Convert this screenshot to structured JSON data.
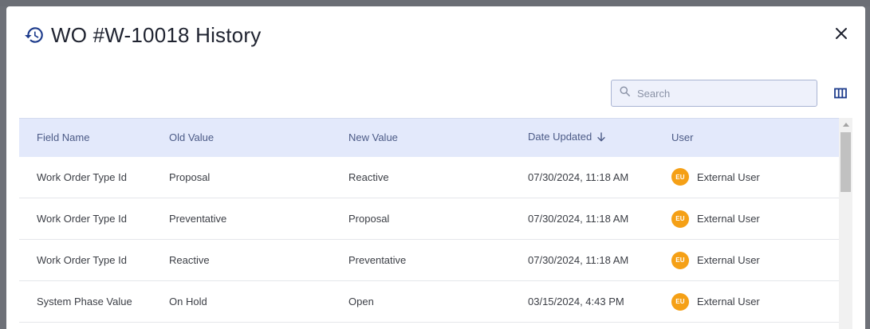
{
  "modal": {
    "title": "WO #W-10018 History",
    "icons": {
      "title": "history-icon",
      "close": "close-icon",
      "search": "search-icon",
      "columns": "columns-icon",
      "sort": "arrow-down-icon"
    }
  },
  "search": {
    "placeholder": "Search",
    "value": ""
  },
  "table": {
    "columns": [
      "Field Name",
      "Old Value",
      "New Value",
      "Date Updated",
      "User"
    ],
    "sorted_column": "Date Updated",
    "sort_direction": "descending",
    "rows": [
      {
        "field_name": "Work Order Type Id",
        "old_value": "Proposal",
        "new_value": "Reactive",
        "date_updated": "07/30/2024, 11:18 AM",
        "user_initials": "EU",
        "user_name": "External User"
      },
      {
        "field_name": "Work Order Type Id",
        "old_value": "Preventative",
        "new_value": "Proposal",
        "date_updated": "07/30/2024, 11:18 AM",
        "user_initials": "EU",
        "user_name": "External User"
      },
      {
        "field_name": "Work Order Type Id",
        "old_value": "Reactive",
        "new_value": "Preventative",
        "date_updated": "07/30/2024, 11:18 AM",
        "user_initials": "EU",
        "user_name": "External User"
      },
      {
        "field_name": "System Phase Value",
        "old_value": "On Hold",
        "new_value": "Open",
        "date_updated": "03/15/2024, 4:43 PM",
        "user_initials": "EU",
        "user_name": "External User"
      }
    ]
  },
  "colors": {
    "accent": "#1e3c8c",
    "header_row": "#e3e9fb",
    "avatar": "#f5a016"
  }
}
